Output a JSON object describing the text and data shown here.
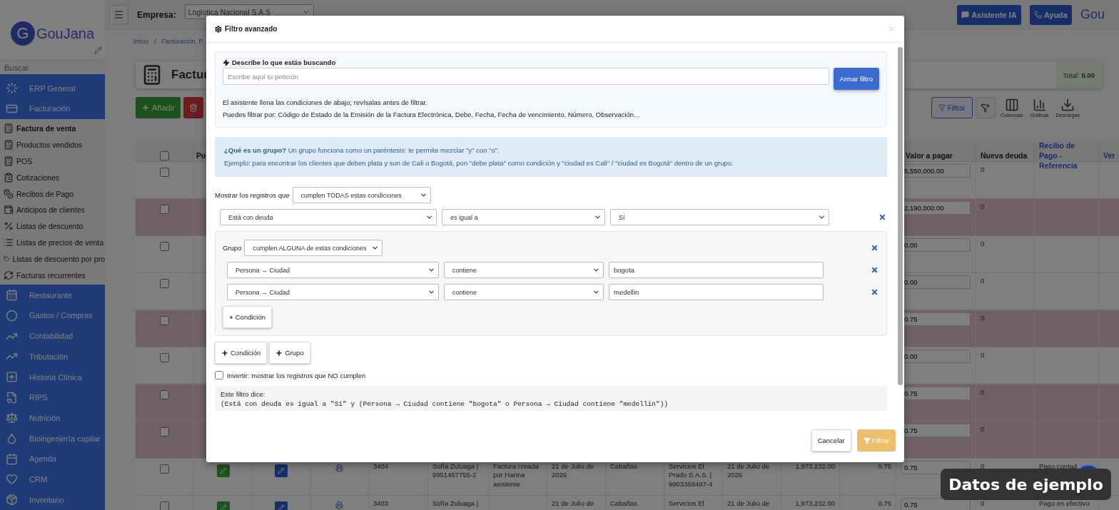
{
  "sidebar": {
    "logo_mark": "G",
    "logo": "GouJana",
    "search": {
      "placeholder": "Buscar"
    },
    "items": [
      {
        "label": "ERP General"
      },
      {
        "label": "Facturación",
        "expanded": true,
        "children": [
          {
            "label": "Factura de venta",
            "selected": true
          },
          {
            "label": "Productos vendidos",
            "selected": false
          },
          {
            "label": "POS",
            "selected": false
          },
          {
            "label": "Cotizaciones",
            "selected": false
          },
          {
            "label": "Recibos de Pago",
            "selected": false
          },
          {
            "label": "Anticipos de clientes",
            "selected": false
          },
          {
            "label": "Listas de descuento",
            "selected": false
          },
          {
            "label": "Listas de precios de venta",
            "selected": false
          },
          {
            "label": "Listas de descuento por pro",
            "selected": false
          },
          {
            "label": "Facturas recurrentes",
            "selected": false
          }
        ]
      },
      {
        "label": "Restaurante"
      },
      {
        "label": "Gastos / Compras"
      },
      {
        "label": "Contabilidad"
      },
      {
        "label": "Tributación"
      },
      {
        "label": "Historia Clínica"
      },
      {
        "label": "RIPS"
      },
      {
        "label": "Nutrición"
      },
      {
        "label": "Bioingeniería capilar"
      },
      {
        "label": "Agenda"
      },
      {
        "label": "CRM"
      },
      {
        "label": "Inventario"
      }
    ]
  },
  "top_bar": {
    "company_label": "Empresa:",
    "company": "Logística Nacional S.A.S",
    "assistant_button": "Asistente IA",
    "help_button": "Ayuda",
    "logo": "Gou"
  },
  "breadcrumb": {
    "separator": "/",
    "items": [
      "Inicio",
      "Facturación, P"
    ]
  },
  "page": {
    "title": "Factur",
    "total_label": "Total:",
    "total": "0.00",
    "add_button": "Añadir"
  },
  "toolbar": [
    {
      "label": "Filtrar",
      "kind": "filter"
    },
    {
      "kind": "clear"
    },
    {
      "label": "Columnas",
      "kind": "columns"
    },
    {
      "label": "Gráficas",
      "kind": "charts"
    },
    {
      "label": "Descargas",
      "kind": "downloads"
    }
  ],
  "table": {
    "header_checked": false,
    "columns": [
      "Po",
      "Valor a pagar",
      "Nueva deuda",
      "Recibo de Pago - Referencia",
      "Ver"
    ],
    "rows": [
      {
        "checked": false,
        "highlighted": false,
        "value_to_pay": "5,550,000.00",
        "new_debt": "0"
      },
      {
        "checked": false,
        "highlighted": true,
        "value_to_pay": "2,190,000.00",
        "new_debt": "0"
      },
      {
        "checked": false,
        "highlighted": false,
        "value_to_pay": "0.00",
        "new_debt": "0"
      },
      {
        "checked": false,
        "highlighted": false,
        "value_to_pay": "0.00",
        "new_debt": "0"
      },
      {
        "checked": false,
        "highlighted": true,
        "value_to_pay": "0.75",
        "new_debt": "0"
      },
      {
        "checked": false,
        "highlighted": false,
        "value_to_pay": "0.00",
        "new_debt": "0"
      },
      {
        "checked": false,
        "highlighted": true,
        "value_to_pay": "0.75",
        "new_debt": "0"
      },
      {
        "checked": false,
        "highlighted": true,
        "value_to_pay": "0.75",
        "new_debt": "0"
      },
      {
        "checked": false,
        "highlighted": false,
        "number": "3404",
        "client": "Sofía Zuluaga | 9951467755-2",
        "observation": "Factura creada por Hanna asistente",
        "date": "21 de Julio de 2026",
        "city": "Cabañas",
        "company": "Servicios El Prado S.A.S. | 9903369497-4",
        "due_date": "21 de Julio de 2026",
        "amount": "1,973,232.00",
        "column_13": "0.75",
        "value_to_pay": "0.75",
        "new_debt": "0",
        "receipt": "Pago contad"
      },
      {
        "checked": false,
        "highlighted": false,
        "number": "3403",
        "client": "Sofía Zuluaga |",
        "date": "21 de Julio de",
        "city": "Cabañas",
        "company": "Servicios El",
        "due_date": "21 de Julio de",
        "amount": "1,973,232.00",
        "column_13": "0.75",
        "value_to_pay": "0.75",
        "new_debt": "0",
        "receipt": "Pago en efectivo"
      }
    ]
  },
  "modal": {
    "title": "Filtro avanzado",
    "assistant": {
      "heading": "Describe lo que estás buscando",
      "placeholder": "Escribe aquí tu petición",
      "button": "Armar filtro",
      "notes": [
        "El asistente llena las condiciones de abajo; revísalas antes de filtrar.",
        "Puedes filtrar por: Código de Estado de la Emisión de la Factura Electrónica, Debe, Fecha, Fecha de vencimiento, Número, Observación…"
      ]
    },
    "info": [
      "**¿Qué es un grupo?** Un grupo funciona como un paréntesis: te permite mezclar \"y\" con \"o\".",
      "Ejemplo: para encontrar los clientes que deben plata y son de Cali o Bogotá, pon \"debe plata\" como condición y \"ciudad es Cali\" / \"ciudad es Bogotá\" dentro de un grupo."
    ],
    "match_label": "Mostrar los registros que",
    "match_mode": "cumplen TODAS estas condiciones",
    "items": [
      {
        "kind": "condition",
        "field": "Está con deuda",
        "operator": "es igual a",
        "value": {
          "kind": "select",
          "text": "Sí"
        }
      },
      {
        "kind": "group",
        "label": "Grupo",
        "match_mode": "cumplen ALGUNA de estas condiciones",
        "add_condition": "Condición",
        "items": [
          {
            "kind": "condition",
            "field": "Persona → Ciudad",
            "operator": "contiene",
            "value": {
              "kind": "text",
              "text": "bogota"
            }
          },
          {
            "kind": "condition",
            "field": "Persona → Ciudad",
            "operator": "contiene",
            "value": {
              "kind": "text",
              "text": "medellin"
            }
          }
        ]
      }
    ],
    "add_buttons": [
      "Condición",
      "Grupo"
    ],
    "invert": {
      "label": "Invertir: mostrar los registros que NO cumplen",
      "checked": false
    },
    "summary_label": "Este filtro dice:",
    "summary": "(Está con deuda es igual a \"Sí\" y (Persona → Ciudad contiene \"bogota\" o Persona → Ciudad contiene \"medellin\"))",
    "cancel": "Cancelar",
    "apply": "Filtrar"
  },
  "badge": "Datos de ejemplo"
}
